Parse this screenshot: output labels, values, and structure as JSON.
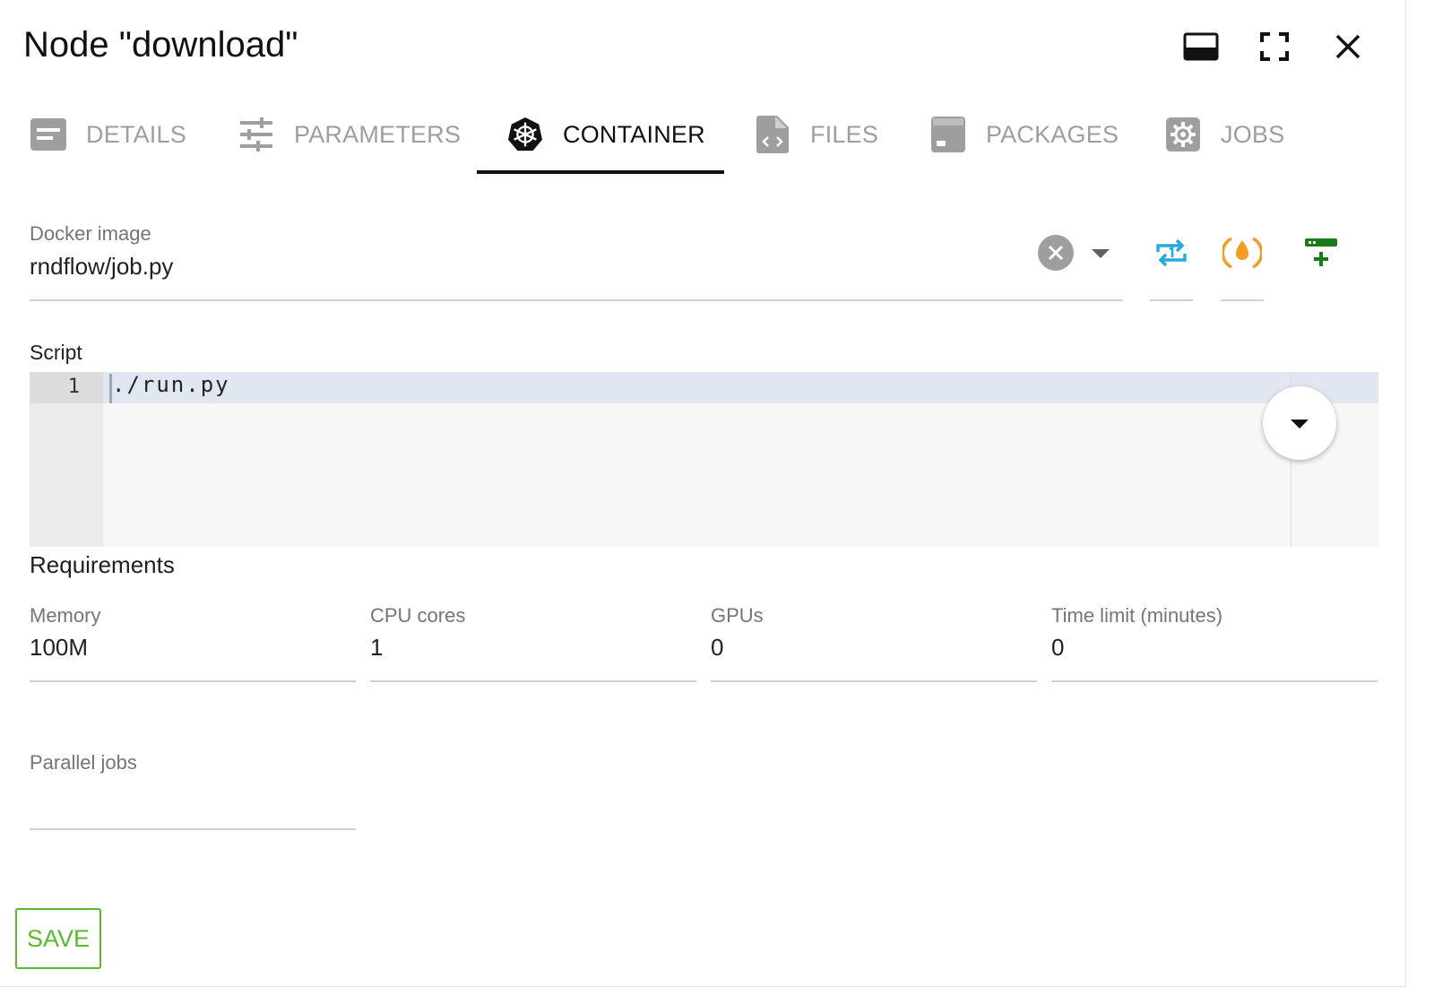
{
  "dialog": {
    "title": "Node \"download\"",
    "header_buttons": [
      {
        "icon": "dock-bottom-icon"
      },
      {
        "icon": "fullscreen-icon"
      },
      {
        "icon": "close-icon"
      }
    ]
  },
  "tabs": [
    {
      "label": "DETAILS",
      "icon": "details-icon",
      "active": false
    },
    {
      "label": "PARAMETERS",
      "icon": "tune-icon",
      "active": false
    },
    {
      "label": "CONTAINER",
      "icon": "kubernetes-icon",
      "active": true
    },
    {
      "label": "FILES",
      "icon": "file-code-icon",
      "active": false
    },
    {
      "label": "PACKAGES",
      "icon": "package-icon",
      "active": false
    },
    {
      "label": "JOBS",
      "icon": "gear-icon",
      "active": false
    }
  ],
  "docker": {
    "label": "Docker image",
    "value": "rndflow/job.py"
  },
  "script": {
    "label": "Script",
    "lines": [
      {
        "number": "1",
        "code": "./run.py"
      }
    ]
  },
  "requirements": {
    "title": "Requirements",
    "fields": [
      {
        "label": "Memory",
        "value": "100M"
      },
      {
        "label": "CPU cores",
        "value": "1"
      },
      {
        "label": "GPUs",
        "value": "0"
      },
      {
        "label": "Time limit (minutes)",
        "value": "0"
      }
    ],
    "parallel": {
      "label": "Parallel jobs",
      "value": ""
    }
  },
  "actions": {
    "save_label": "SAVE"
  },
  "colors": {
    "accent_green": "#5bb82f",
    "tool_blue": "#29a8e0",
    "tool_orange": "#f59a23",
    "tool_darkgreen": "#1b7a1b"
  }
}
